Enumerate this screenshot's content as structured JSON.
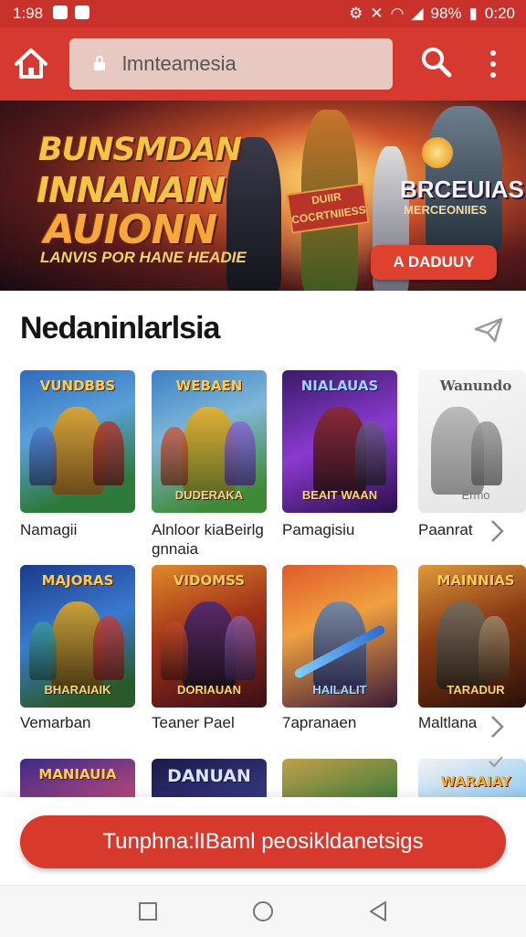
{
  "status_bar": {
    "time": "1:98",
    "battery": "98%",
    "clock_right": "0:20"
  },
  "app_bar": {
    "search_text": "lmnteamesia"
  },
  "banner": {
    "title_line1": "BUNSMDAN",
    "title_line2": "INNANAIN",
    "title_line3": "AUIONN",
    "subtitle": "LANVIS POR HANE HEADIE",
    "badge_text": "DUIIR COCRTNIIESS",
    "right_title": "BRCEUIAS",
    "right_subtitle": "MERCEONIIES",
    "cta_label": "A DADUUY"
  },
  "section": {
    "title": "Nedaninlarlsia"
  },
  "games_row1": [
    {
      "art_title": "VUNDBBS",
      "art_sub": "",
      "label": "Namagii"
    },
    {
      "art_title": "WEBAEN",
      "art_sub": "DUDERAKA",
      "label": "Alnloor kiaBeirlg gnnaia"
    },
    {
      "art_title": "NIALAUAS",
      "art_sub": "BEAIT WAAN",
      "label": "Pamagisiu"
    },
    {
      "art_title": "Wanundo",
      "art_sub": "Ermo",
      "label": "Paanrat"
    }
  ],
  "games_row2": [
    {
      "art_title": "MAJORAS",
      "art_sub": "BHARAIAIK",
      "label": "Vemarban"
    },
    {
      "art_title": "VIDOMSS",
      "art_sub": "DORIAUAN",
      "label": "Teaner Pael"
    },
    {
      "art_title": "",
      "art_sub": "HAILALIT",
      "label": "7apranaen"
    },
    {
      "art_title": "MAINNIAS",
      "art_sub": "TARADUR",
      "label": "Maltlana"
    }
  ],
  "games_row3": [
    {
      "art_title": "MANIAUIA"
    },
    {
      "art_title": "DANUAN"
    },
    {
      "art_title": ""
    },
    {
      "art_title": "WARAIAY"
    }
  ],
  "bottom_cta": {
    "label": "Tunphna:lIBaml peosikldanetsigs"
  },
  "colors": {
    "brand_red": "#d6392f",
    "cta_red": "#d7392c",
    "search_bg": "#e7c9c2"
  }
}
